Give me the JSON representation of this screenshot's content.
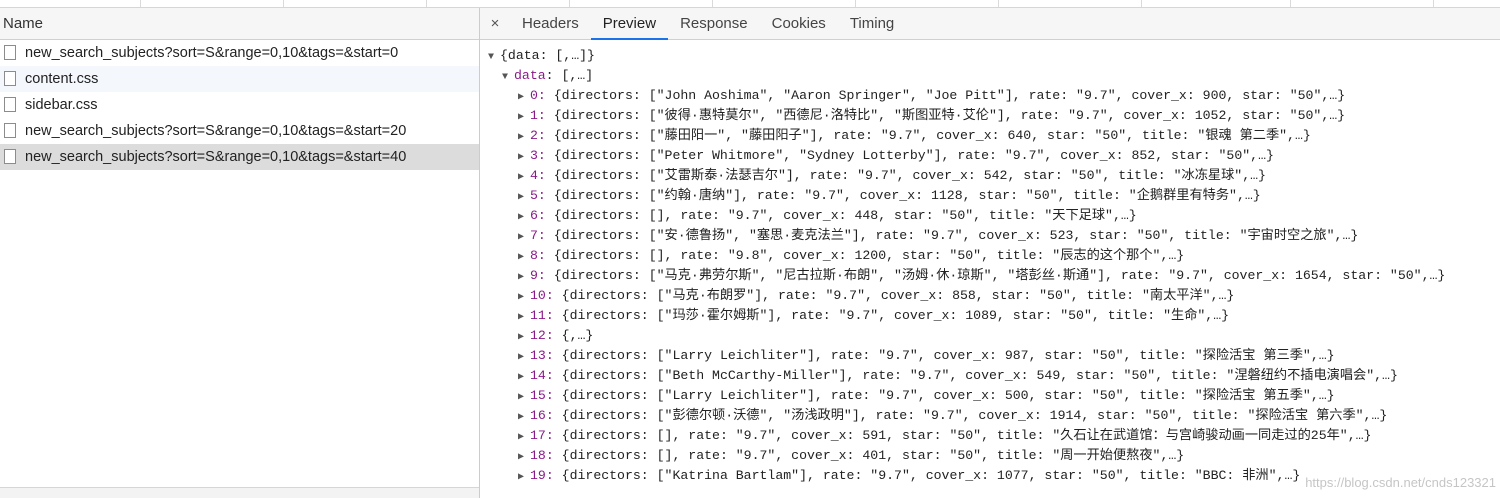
{
  "left": {
    "header": "Name",
    "requests": [
      {
        "name": "new_search_subjects?sort=S&range=0,10&tags=&start=0"
      },
      {
        "name": "content.css"
      },
      {
        "name": "sidebar.css"
      },
      {
        "name": "new_search_subjects?sort=S&range=0,10&tags=&start=20"
      },
      {
        "name": "new_search_subjects?sort=S&range=0,10&tags=&start=40"
      }
    ]
  },
  "tabs": {
    "close": "×",
    "items": [
      {
        "label": "Headers"
      },
      {
        "label": "Preview"
      },
      {
        "label": "Response"
      },
      {
        "label": "Cookies"
      },
      {
        "label": "Timing"
      }
    ]
  },
  "preview": {
    "root": "{data: [,…]}",
    "data_key": "data",
    "data_summary": ": [,…]",
    "rows": [
      {
        "index": "0:",
        "text": " {directors: [\"John Aoshima\", \"Aaron Springer\", \"Joe Pitt\"], rate: \"9.7\", cover_x: 900, star: \"50\",…}"
      },
      {
        "index": "1:",
        "text": " {directors: [\"彼得·惠特莫尔\", \"西德尼·洛特比\", \"斯图亚特·艾伦\"], rate: \"9.7\", cover_x: 1052, star: \"50\",…}"
      },
      {
        "index": "2:",
        "text": " {directors: [\"藤田阳一\", \"藤田阳子\"], rate: \"9.7\", cover_x: 640, star: \"50\", title: \"银魂 第二季\",…}"
      },
      {
        "index": "3:",
        "text": " {directors: [\"Peter Whitmore\", \"Sydney Lotterby\"], rate: \"9.7\", cover_x: 852, star: \"50\",…}"
      },
      {
        "index": "4:",
        "text": " {directors: [\"艾雷斯泰·法瑟吉尔\"], rate: \"9.7\", cover_x: 542, star: \"50\", title: \"冰冻星球\",…}"
      },
      {
        "index": "5:",
        "text": " {directors: [\"约翰·唐纳\"], rate: \"9.7\", cover_x: 1128, star: \"50\", title: \"企鹅群里有特务\",…}"
      },
      {
        "index": "6:",
        "text": " {directors: [], rate: \"9.7\", cover_x: 448, star: \"50\", title: \"天下足球\",…}"
      },
      {
        "index": "7:",
        "text": " {directors: [\"安·德鲁扬\", \"塞思·麦克法兰\"], rate: \"9.7\", cover_x: 523, star: \"50\", title: \"宇宙时空之旅\",…}"
      },
      {
        "index": "8:",
        "text": " {directors: [], rate: \"9.8\", cover_x: 1200, star: \"50\", title: \"辰志的这个那个\",…}"
      },
      {
        "index": "9:",
        "text": " {directors: [\"马克·弗劳尔斯\", \"尼古拉斯·布朗\", \"汤姆·休·琼斯\", \"塔彭丝·斯通\"], rate: \"9.7\", cover_x: 1654, star: \"50\",…}"
      },
      {
        "index": "10:",
        "text": " {directors: [\"马克·布朗罗\"], rate: \"9.7\", cover_x: 858, star: \"50\", title: \"南太平洋\",…}"
      },
      {
        "index": "11:",
        "text": " {directors: [\"玛莎·霍尔姆斯\"], rate: \"9.7\", cover_x: 1089, star: \"50\", title: \"生命\",…}"
      },
      {
        "index": "12:",
        "text": " {,…}"
      },
      {
        "index": "13:",
        "text": " {directors: [\"Larry Leichliter\"], rate: \"9.7\", cover_x: 987, star: \"50\", title: \"探险活宝 第三季\",…}"
      },
      {
        "index": "14:",
        "text": " {directors: [\"Beth McCarthy-Miller\"], rate: \"9.7\", cover_x: 549, star: \"50\", title: \"涅磐纽约不插电演唱会\",…}"
      },
      {
        "index": "15:",
        "text": " {directors: [\"Larry Leichliter\"], rate: \"9.7\", cover_x: 500, star: \"50\", title: \"探险活宝 第五季\",…}"
      },
      {
        "index": "16:",
        "text": " {directors: [\"彭德尔顿·沃德\", \"汤浅政明\"], rate: \"9.7\", cover_x: 1914, star: \"50\", title: \"探险活宝 第六季\",…}"
      },
      {
        "index": "17:",
        "text": " {directors: [], rate: \"9.7\", cover_x: 591, star: \"50\", title: \"久石让在武道馆：与宫崎骏动画一同走过的25年\",…}"
      },
      {
        "index": "18:",
        "text": " {directors: [], rate: \"9.7\", cover_x: 401, star: \"50\", title: \"周一开始便熬夜\",…}"
      },
      {
        "index": "19:",
        "text": " {directors: [\"Katrina Bartlam\"], rate: \"9.7\", cover_x: 1077, star: \"50\", title: \"BBC: 非洲\",…}"
      }
    ]
  },
  "watermark": "https://blog.csdn.net/cnds123321",
  "colors": {
    "accent": "#1a73e8",
    "selected_row": "#dcdcdc",
    "key": "#8a1a8a"
  }
}
